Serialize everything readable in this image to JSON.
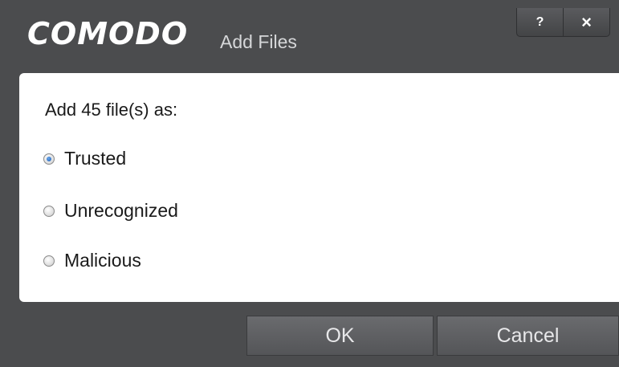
{
  "window": {
    "brand": "COMODO",
    "title": "Add Files",
    "help_label": "?",
    "close_label": "×"
  },
  "body": {
    "prompt": "Add 45 file(s) as:",
    "options": [
      {
        "label": "Trusted",
        "selected": true
      },
      {
        "label": "Unrecognized",
        "selected": false
      },
      {
        "label": "Malicious",
        "selected": false
      }
    ]
  },
  "footer": {
    "ok_label": "OK",
    "cancel_label": "Cancel"
  }
}
